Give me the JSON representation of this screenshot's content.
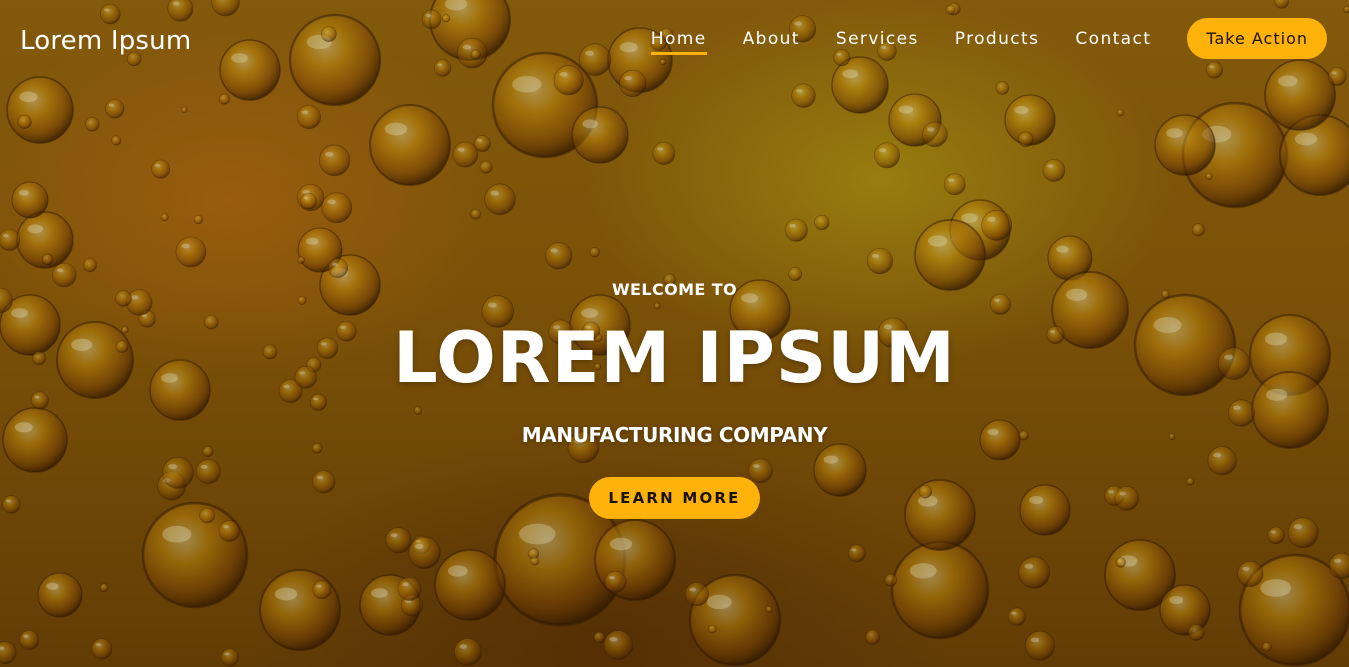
{
  "header": {
    "brand": "Lorem Ipsum",
    "nav": [
      {
        "label": "Home",
        "active": true
      },
      {
        "label": "About",
        "active": false
      },
      {
        "label": "Services",
        "active": false
      },
      {
        "label": "Products",
        "active": false
      },
      {
        "label": "Contact",
        "active": false
      }
    ],
    "cta_label": "Take Action"
  },
  "hero": {
    "eyebrow": "WELCOME TO",
    "title": "LOREM IPSUM",
    "subtitle": "MANUFACTURING COMPANY",
    "button_label": "LEARN MORE",
    "background": "amber-bubbles-image"
  },
  "colors": {
    "accent": "#ffb20a",
    "text": "#ffffff",
    "button_text": "#1a1205"
  }
}
